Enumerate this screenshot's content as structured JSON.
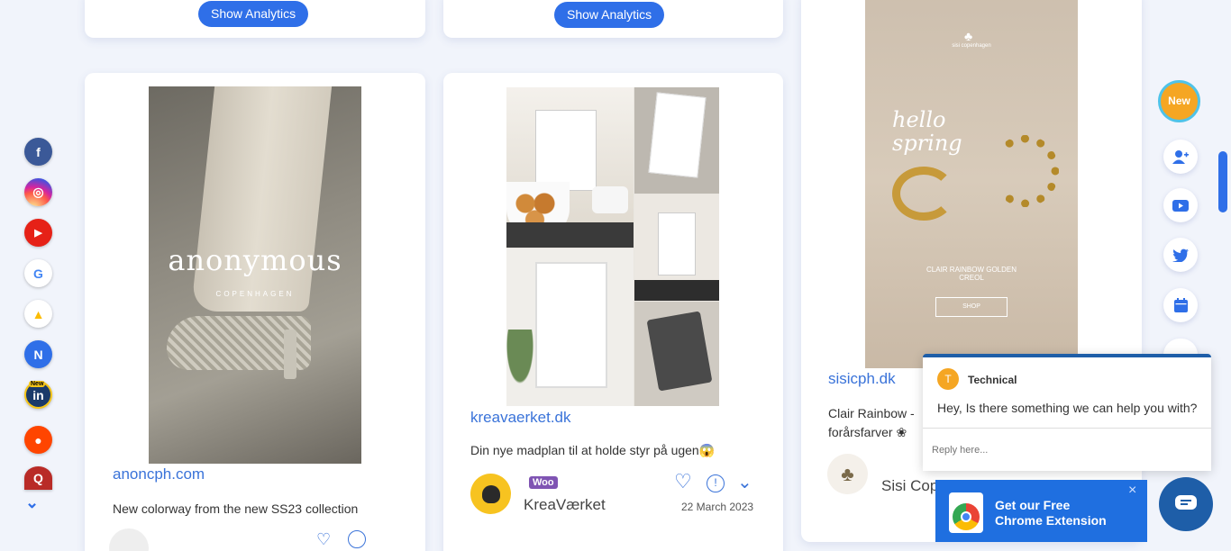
{
  "analytics_label": "Show Analytics",
  "posts": [
    {
      "domain": "anoncph.com",
      "caption": "New colorway from the new SS23 collection",
      "brand_text": "anonymous",
      "brand_sub": "COPENHAGEN"
    },
    {
      "domain": "kreavaerket.dk",
      "caption": "Din nye madplan til at holde styr på ugen😱",
      "author": "KreaVærket",
      "badge": "Woo",
      "date": "22 March 2023"
    },
    {
      "domain": "sisicph.dk",
      "caption": "Clair Rainbow - ",
      "caption_line2": "forårsfarver ❀",
      "author": "Sisi Cop",
      "img_top": "sisi copenhagen",
      "img_script": "hello spring",
      "img_product": "CLAIR RAINBOW GOLDEN CREOL",
      "img_shop": "SHOP"
    }
  ],
  "left_rail": [
    {
      "name": "facebook",
      "glyph": "f",
      "color": "#3b5998"
    },
    {
      "name": "instagram",
      "glyph": "◎",
      "color": "#d6249f"
    },
    {
      "name": "youtube",
      "glyph": "▶",
      "color": "#e62117"
    },
    {
      "name": "google",
      "glyph": "G",
      "color": "#ffffff"
    },
    {
      "name": "google-ads",
      "glyph": "▲",
      "color": "#ffffff"
    },
    {
      "name": "n",
      "glyph": "N",
      "color": "#2f6fe8"
    },
    {
      "name": "linkedin",
      "glyph": "in",
      "color": "#1a3a6a",
      "badge": "New"
    },
    {
      "name": "reddit",
      "glyph": "●",
      "color": "#ff4500"
    },
    {
      "name": "quora",
      "glyph": "Q",
      "color": "#b92b27"
    }
  ],
  "right_rail": {
    "new_label": "New",
    "icons": [
      "add-user-icon",
      "youtube-icon",
      "twitter-icon",
      "calendar-icon"
    ]
  },
  "chat": {
    "avatar_letter": "T",
    "agent": "Technical",
    "message": "Hey, Is there something we can help you with?",
    "placeholder": "Reply here..."
  },
  "extension": {
    "line1": "Get our Free",
    "line2": "Chrome Extension",
    "close": "×"
  },
  "colors": {
    "accent": "#2f6fe8",
    "link": "#3a73d9",
    "chat_border": "#1e5ea8",
    "new_badge": "#f5a623"
  }
}
